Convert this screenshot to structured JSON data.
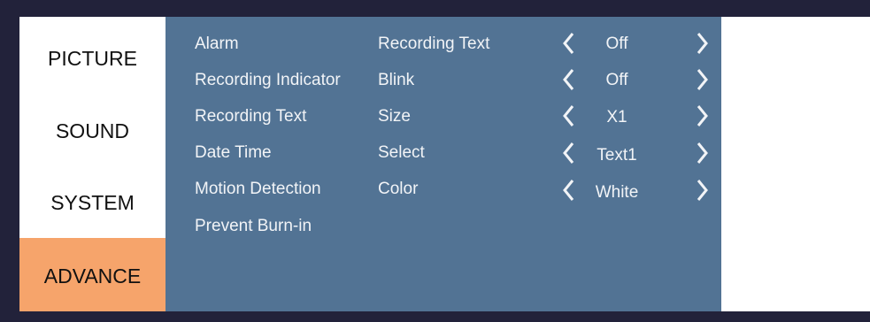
{
  "sidebar": {
    "items": [
      {
        "label": "PICTURE"
      },
      {
        "label": "SOUND"
      },
      {
        "label": "SYSTEM"
      },
      {
        "label": "ADVANCE",
        "active": true
      }
    ]
  },
  "menu": {
    "items": [
      {
        "label": "Alarm"
      },
      {
        "label": "Recording Indicator"
      },
      {
        "label": "Recording Text"
      },
      {
        "label": "Date Time"
      },
      {
        "label": "Motion Detection"
      },
      {
        "label": "Prevent Burn-in"
      }
    ]
  },
  "options": [
    {
      "label": "Recording Text",
      "value": "Off"
    },
    {
      "label": "Blink",
      "value": "Off"
    },
    {
      "label": "Size",
      "value": "X1"
    },
    {
      "label": "Select",
      "value": "Text1"
    },
    {
      "label": "Color",
      "value": "White"
    }
  ],
  "icons": {
    "prev": "chevron-left-icon",
    "next": "chevron-right-icon"
  },
  "colors": {
    "panel": "#527394",
    "active_tab": "#f6a46b",
    "frame": "#22223a"
  }
}
